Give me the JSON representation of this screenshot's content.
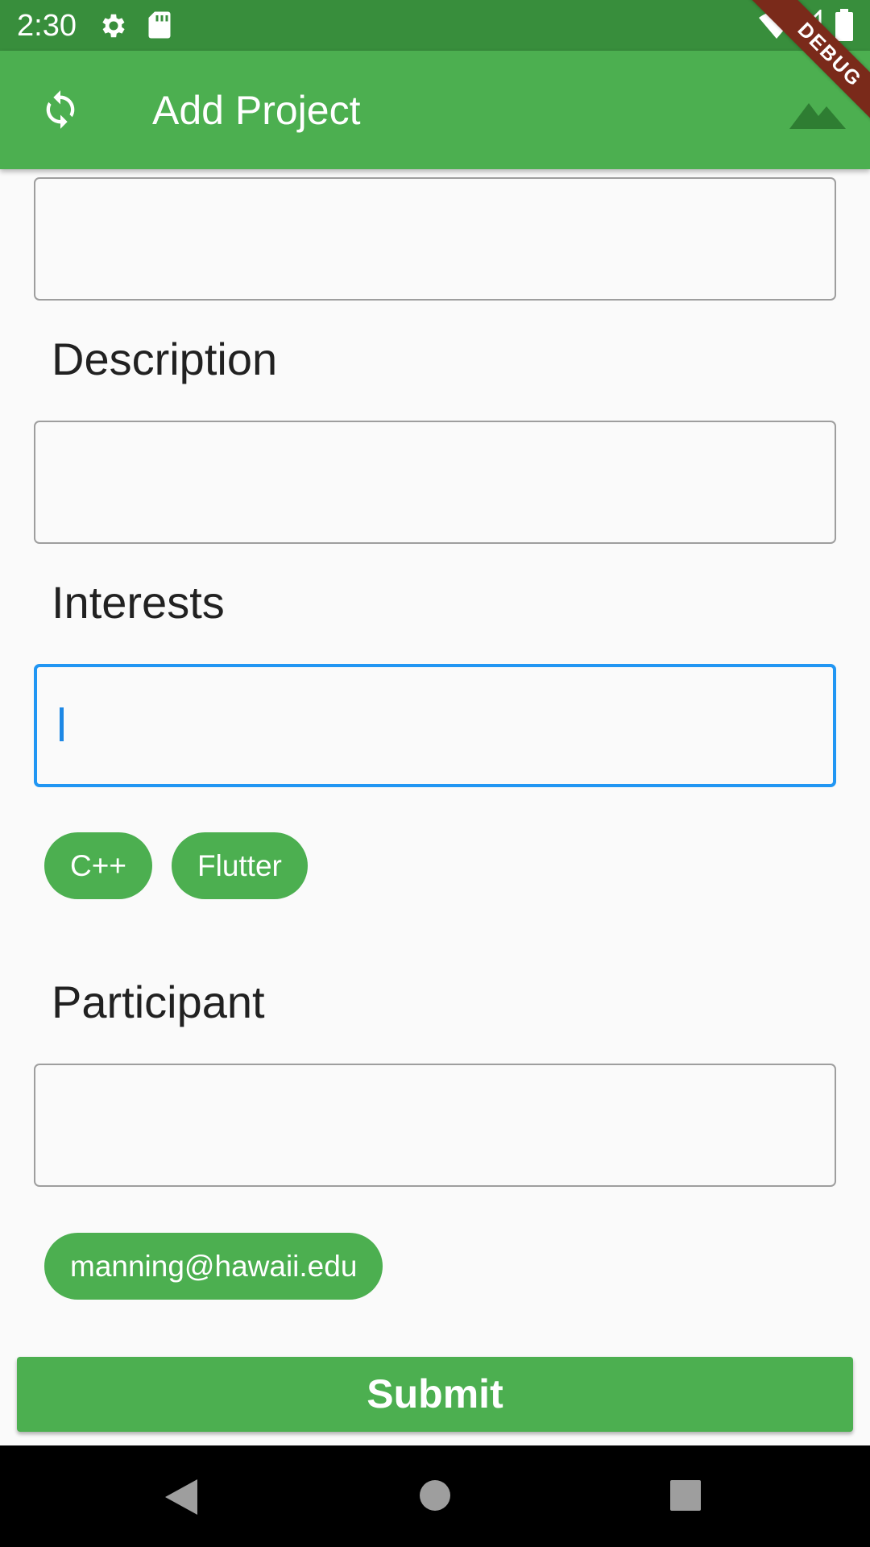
{
  "status_bar": {
    "time": "2:30",
    "icons": [
      "gear-icon",
      "sd-card-icon",
      "wifi-icon",
      "cell-signal-icon",
      "battery-icon"
    ]
  },
  "app_bar": {
    "title": "Add Project",
    "leading_icon": "refresh-icon",
    "trailing_icon": "mountain-icon",
    "color": "#4caf50"
  },
  "debug_banner": "DEBUG",
  "form": {
    "title_value": "",
    "description_label": "Description",
    "description_value": "",
    "interests_label": "Interests",
    "interests_value": "",
    "interest_chips": [
      "C++",
      "Flutter"
    ],
    "participant_label": "Participant",
    "participant_value": "",
    "participant_chips": [
      "manning@hawaii.edu"
    ]
  },
  "submit_label": "Submit",
  "nav_bar": {
    "icons": [
      "back-icon",
      "home-icon",
      "recents-icon"
    ]
  },
  "colors": {
    "status_bar": "#388e3c",
    "accent": "#4caf50",
    "focus": "#2196f3",
    "background": "#fafafa"
  }
}
